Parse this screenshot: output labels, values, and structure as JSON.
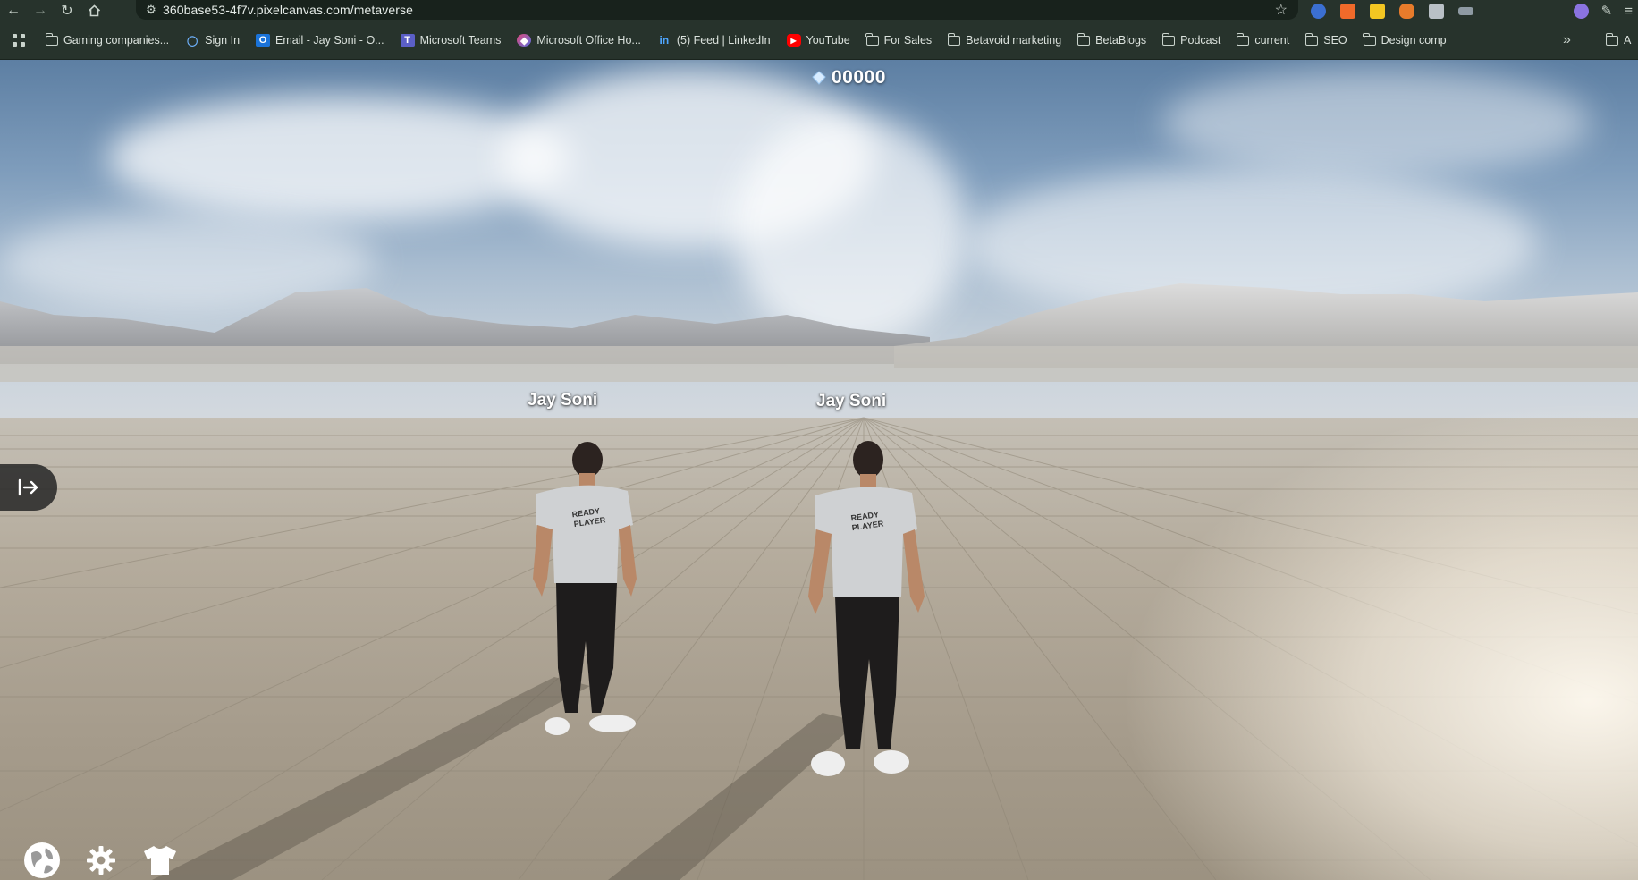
{
  "browser": {
    "url": "360base53-4f7v.pixelcanvas.com/metaverse",
    "bookmarks": [
      {
        "label": "Gaming companies...",
        "icon": "folder-icon"
      },
      {
        "label": "Sign In",
        "icon": "signin-site-icon"
      },
      {
        "label": "Email - Jay Soni - O...",
        "icon": "outlook-icon"
      },
      {
        "label": "Microsoft Teams",
        "icon": "teams-icon"
      },
      {
        "label": "Microsoft Office Ho...",
        "icon": "office-icon"
      },
      {
        "label": "(5) Feed | LinkedIn",
        "icon": "linkedin-icon"
      },
      {
        "label": "YouTube",
        "icon": "youtube-icon"
      },
      {
        "label": "For Sales",
        "icon": "folder-icon"
      },
      {
        "label": "Betavoid marketing",
        "icon": "folder-icon"
      },
      {
        "label": "BetaBlogs",
        "icon": "folder-icon"
      },
      {
        "label": "Podcast",
        "icon": "folder-icon"
      },
      {
        "label": "current",
        "icon": "folder-icon"
      },
      {
        "label": "SEO",
        "icon": "folder-icon"
      },
      {
        "label": "Design comp",
        "icon": "folder-icon"
      }
    ],
    "overflow_bookmark": "A"
  },
  "game": {
    "score": "00000",
    "players": [
      {
        "name": "Jay Soni"
      },
      {
        "name": "Jay Soni"
      }
    ],
    "bottom_controls": [
      "globe-icon",
      "settings-gear-icon",
      "tshirt-outfit-icon"
    ]
  }
}
